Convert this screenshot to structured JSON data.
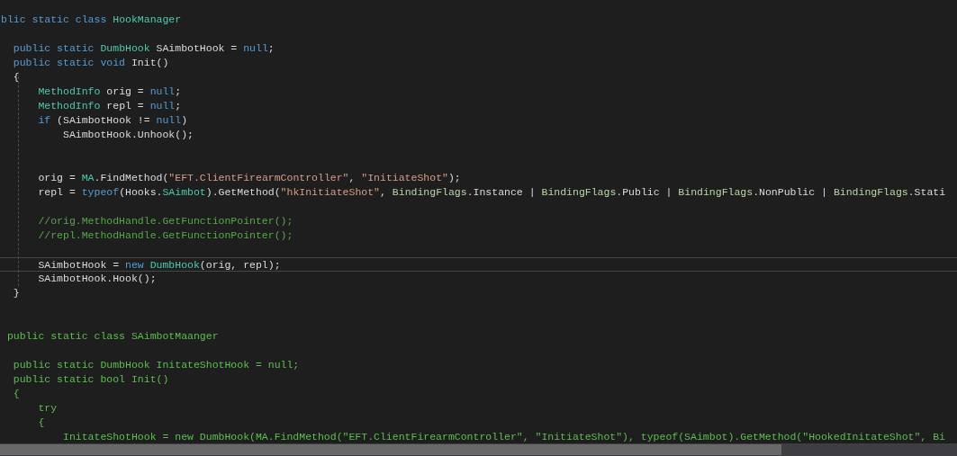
{
  "editor": {
    "lines": [
      {
        "kind": "code",
        "current": false,
        "tokens": [
          {
            "text": "blic static class ",
            "kind": "keyword"
          },
          {
            "text": "HookManager",
            "kind": "type"
          }
        ]
      },
      {
        "kind": "blank"
      },
      {
        "kind": "code",
        "current": false,
        "tokens": [
          {
            "text": "  public static ",
            "kind": "keyword"
          },
          {
            "text": "DumbHook",
            "kind": "type"
          },
          {
            "text": " SAimbotHook = ",
            "kind": "plain"
          },
          {
            "text": "null",
            "kind": "keyword"
          },
          {
            "text": ";",
            "kind": "plain"
          }
        ]
      },
      {
        "kind": "code",
        "current": false,
        "tokens": [
          {
            "text": "  public static void ",
            "kind": "keyword"
          },
          {
            "text": "Init()",
            "kind": "plain"
          }
        ]
      },
      {
        "kind": "code",
        "current": false,
        "tokens": [
          {
            "text": "  {",
            "kind": "plain"
          }
        ]
      },
      {
        "kind": "code",
        "current": false,
        "tokens": [
          {
            "text": "      MethodInfo",
            "kind": "type"
          },
          {
            "text": " orig = ",
            "kind": "plain"
          },
          {
            "text": "null",
            "kind": "keyword"
          },
          {
            "text": ";",
            "kind": "plain"
          }
        ]
      },
      {
        "kind": "code",
        "current": false,
        "tokens": [
          {
            "text": "      MethodInfo",
            "kind": "type"
          },
          {
            "text": " repl = ",
            "kind": "plain"
          },
          {
            "text": "null",
            "kind": "keyword"
          },
          {
            "text": ";",
            "kind": "plain"
          }
        ]
      },
      {
        "kind": "code",
        "current": false,
        "tokens": [
          {
            "text": "      if",
            "kind": "keyword"
          },
          {
            "text": " (SAimbotHook != ",
            "kind": "plain"
          },
          {
            "text": "null",
            "kind": "keyword"
          },
          {
            "text": ")",
            "kind": "plain"
          }
        ]
      },
      {
        "kind": "code",
        "current": false,
        "tokens": [
          {
            "text": "          SAimbotHook.Unhook();",
            "kind": "plain"
          }
        ]
      },
      {
        "kind": "blank"
      },
      {
        "kind": "blank"
      },
      {
        "kind": "code",
        "current": false,
        "tokens": [
          {
            "text": "      orig = ",
            "kind": "plain"
          },
          {
            "text": "MA",
            "kind": "type"
          },
          {
            "text": ".FindMethod(",
            "kind": "plain"
          },
          {
            "text": "\"EFT.ClientFirearmController\"",
            "kind": "string"
          },
          {
            "text": ", ",
            "kind": "plain"
          },
          {
            "text": "\"InitiateShot\"",
            "kind": "string"
          },
          {
            "text": ");",
            "kind": "plain"
          }
        ]
      },
      {
        "kind": "code",
        "current": false,
        "tokens": [
          {
            "text": "      repl = ",
            "kind": "plain"
          },
          {
            "text": "typeof",
            "kind": "keyword"
          },
          {
            "text": "(Hooks.",
            "kind": "plain"
          },
          {
            "text": "SAimbot",
            "kind": "type"
          },
          {
            "text": ").GetMethod(",
            "kind": "plain"
          },
          {
            "text": "\"hkInitiateShot\"",
            "kind": "string"
          },
          {
            "text": ", ",
            "kind": "plain"
          },
          {
            "text": "BindingFlags",
            "kind": "enum"
          },
          {
            "text": ".Instance | ",
            "kind": "plain"
          },
          {
            "text": "BindingFlags",
            "kind": "enum"
          },
          {
            "text": ".Public | ",
            "kind": "plain"
          },
          {
            "text": "BindingFlags",
            "kind": "enum"
          },
          {
            "text": ".NonPublic | ",
            "kind": "plain"
          },
          {
            "text": "BindingFlags",
            "kind": "enum"
          },
          {
            "text": ".Stati",
            "kind": "plain"
          }
        ]
      },
      {
        "kind": "blank"
      },
      {
        "kind": "code",
        "current": false,
        "tokens": [
          {
            "text": "      //orig.MethodHandle.GetFunctionPointer();",
            "kind": "comment"
          }
        ]
      },
      {
        "kind": "code",
        "current": false,
        "tokens": [
          {
            "text": "      //repl.MethodHandle.GetFunctionPointer();",
            "kind": "comment"
          }
        ]
      },
      {
        "kind": "blank"
      },
      {
        "kind": "code",
        "current": true,
        "tokens": [
          {
            "text": "      SAimbotHook = ",
            "kind": "plain"
          },
          {
            "text": "new ",
            "kind": "keyword"
          },
          {
            "text": "DumbHook",
            "kind": "type"
          },
          {
            "text": "(orig, repl);",
            "kind": "plain"
          }
        ]
      },
      {
        "kind": "code",
        "current": false,
        "tokens": [
          {
            "text": "      SAimbotHook.Hook();",
            "kind": "plain"
          }
        ]
      },
      {
        "kind": "code",
        "current": false,
        "tokens": [
          {
            "text": "  }",
            "kind": "plain"
          }
        ]
      },
      {
        "kind": "blank"
      },
      {
        "kind": "blank"
      },
      {
        "kind": "code",
        "current": false,
        "tokens": [
          {
            "text": " public static class SAimbotMaanger",
            "kind": "inactive"
          }
        ]
      },
      {
        "kind": "blank"
      },
      {
        "kind": "code",
        "current": false,
        "tokens": [
          {
            "text": "  public static DumbHook InitateShotHook = null;",
            "kind": "inactive"
          }
        ]
      },
      {
        "kind": "code",
        "current": false,
        "tokens": [
          {
            "text": "  public static bool Init()",
            "kind": "inactive"
          }
        ]
      },
      {
        "kind": "code",
        "current": false,
        "tokens": [
          {
            "text": "  {",
            "kind": "inactive"
          }
        ]
      },
      {
        "kind": "code",
        "current": false,
        "tokens": [
          {
            "text": "      try",
            "kind": "inactive"
          }
        ]
      },
      {
        "kind": "code",
        "current": false,
        "tokens": [
          {
            "text": "      {",
            "kind": "inactive"
          }
        ]
      },
      {
        "kind": "code",
        "current": false,
        "tokens": [
          {
            "text": "          InitateShotHook = new DumbHook(MA.FindMethod(\"EFT.ClientFirearmController\", \"InitiateShot\"), typeof(SAimbot).GetMethod(\"HookedInitateShot\", Bi",
            "kind": "inactive"
          }
        ]
      }
    ]
  }
}
